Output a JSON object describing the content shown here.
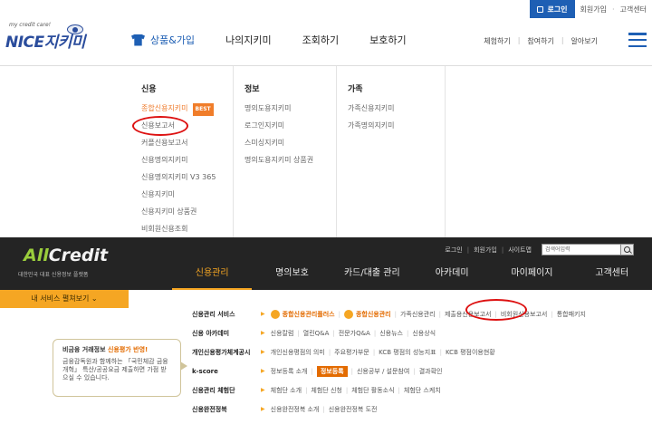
{
  "nice": {
    "util": {
      "login": "로그인",
      "join": "회원가입",
      "support": "고객센터"
    },
    "logo": {
      "small": "my credit care!",
      "main": "NICE지키미"
    },
    "gnb": [
      "상품&가입",
      "나의지키미",
      "조회하기",
      "보호하기"
    ],
    "sub_util": [
      "체험하기",
      "참여하기",
      "알아보기"
    ],
    "menu": {
      "col1": {
        "head": "신용",
        "best_badge": "BEST",
        "items": [
          "종합신용지키미",
          "신용보고서",
          "커플신용보고서",
          "신용명의지키미",
          "신용명의지키미 V3 365",
          "신용지키미",
          "신용지키미 상품권",
          "비회원신용조회"
        ]
      },
      "col2": {
        "head": "정보",
        "items": [
          "명의도용지키미",
          "로그인지키미",
          "스미싱지키미",
          "명의도용지키미 상품권"
        ]
      },
      "col3": {
        "head": "가족",
        "items": [
          "가족신용지키미",
          "가족명의지키미"
        ]
      }
    }
  },
  "allcredit": {
    "logo": {
      "all": "All",
      "credit": "Credit"
    },
    "tagline": "대한민국 대표 신용정보 플랫폼",
    "util": [
      "로그인",
      "회원가입",
      "사이트맵"
    ],
    "search_placeholder": "검색어입력",
    "gnb": [
      "신용관리",
      "명의보호",
      "카드/대출 관리",
      "아카데미",
      "마이페이지",
      "고객센터"
    ],
    "service_button": "내 서비스 펼쳐보기 ⌄",
    "rows": [
      {
        "head": "신용관리 서비스",
        "items": [
          "종합신용관리플러스",
          "종합신용관리",
          "가족신용관리",
          "제출용신용보고서",
          "비회원신용보고서",
          "통합패키지"
        ]
      },
      {
        "head": "신용 아카데미",
        "items": [
          "신용칼럼",
          "열린Q&A",
          "전문가Q&A",
          "신용뉴스",
          "신용상식"
        ]
      },
      {
        "head": "개인신용평가체계공시",
        "items": [
          "개인신용평점의 의미",
          "주요평가부문",
          "KCB 평점의 성능지표",
          "KCB 평점이용현황"
        ]
      },
      {
        "head": "k-score",
        "items": [
          "정보등록 소개",
          "정보등록",
          "신용공부 / 설문참여",
          "결과확인"
        ]
      },
      {
        "head": "신용관리 체험단",
        "items": [
          "체험단 소개",
          "체험단 신청",
          "체험단 활동소식",
          "체험단 스케치"
        ]
      },
      {
        "head": "신용완전정복",
        "items": [
          "신용완전정복 소개",
          "신용완전정복 도전"
        ]
      }
    ],
    "tooltip": {
      "title_plain": "비금융 거래정보 ",
      "title_accent": "신용평가 반영!",
      "body": "금융감독원과 함께하는 「국민체감 금융개혁」 특산/공공요금 제출하면 가점 받으실 수 있습니다."
    }
  }
}
